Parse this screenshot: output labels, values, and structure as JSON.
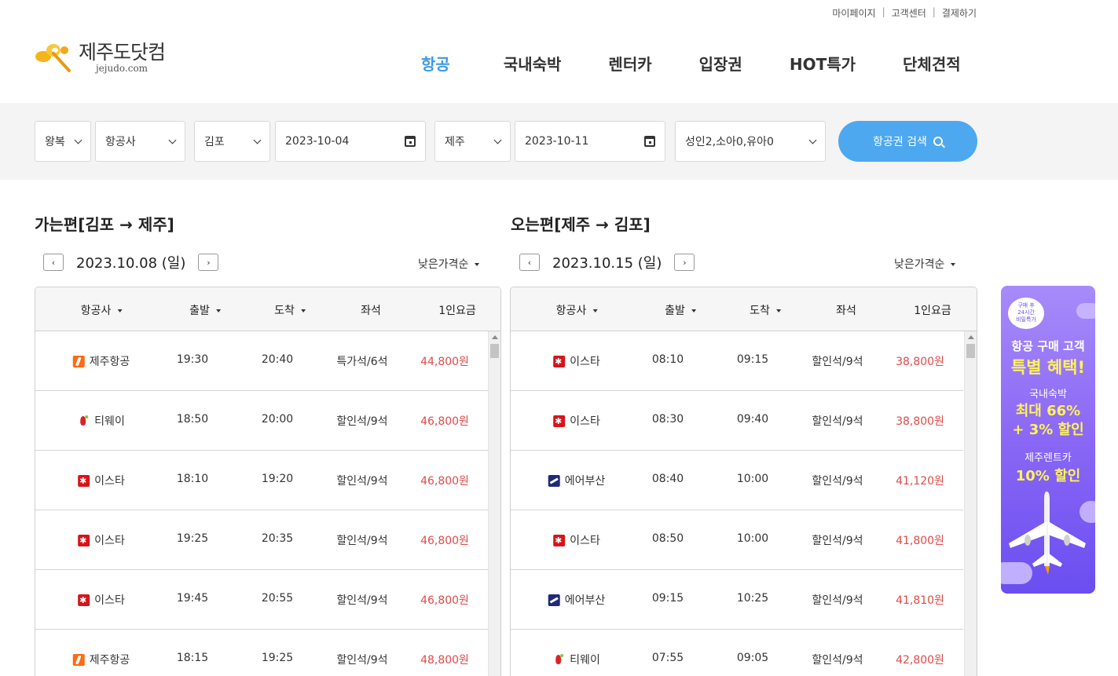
{
  "topnav": [
    "마이페이지",
    "고객센터",
    "결제하기"
  ],
  "logo": {
    "ko": "제주도닷컴",
    "en": "jejudo.com"
  },
  "mainnav": [
    {
      "label": "항공",
      "active": true
    },
    {
      "label": "국내숙박",
      "active": false
    },
    {
      "label": "렌터카",
      "active": false
    },
    {
      "label": "입장권",
      "active": false
    },
    {
      "label": "HOT특가",
      "active": false
    },
    {
      "label": "단체견적",
      "active": false
    }
  ],
  "search": {
    "trip_type": "왕복",
    "airline": "항공사",
    "origin": "김포",
    "depart_date": "2023-10-04",
    "destination": "제주",
    "return_date": "2023-10-11",
    "passengers": "성인2,소아0,유아0",
    "button": "항공권 검색"
  },
  "outbound": {
    "title": "가는편[김포 → 제주]",
    "date": "2023.10.08 (일)",
    "sort": "낮은가격순",
    "headers": [
      "항공사",
      "출발",
      "도착",
      "좌석",
      "1인요금"
    ],
    "rows": [
      {
        "airline": "제주항공",
        "logo": "jeju",
        "dep": "19:30",
        "arr": "20:40",
        "seat": "특가석/6석",
        "price": "44,800원"
      },
      {
        "airline": "티웨이",
        "logo": "tway",
        "dep": "18:50",
        "arr": "20:00",
        "seat": "할인석/9석",
        "price": "46,800원"
      },
      {
        "airline": "이스타",
        "logo": "eastar",
        "dep": "18:10",
        "arr": "19:20",
        "seat": "할인석/9석",
        "price": "46,800원"
      },
      {
        "airline": "이스타",
        "logo": "eastar",
        "dep": "19:25",
        "arr": "20:35",
        "seat": "할인석/9석",
        "price": "46,800원"
      },
      {
        "airline": "이스타",
        "logo": "eastar",
        "dep": "19:45",
        "arr": "20:55",
        "seat": "할인석/9석",
        "price": "46,800원"
      },
      {
        "airline": "제주항공",
        "logo": "jeju",
        "dep": "18:15",
        "arr": "19:25",
        "seat": "할인석/9석",
        "price": "48,800원"
      }
    ]
  },
  "inbound": {
    "title": "오는편[제주 → 김포]",
    "date": "2023.10.15 (일)",
    "sort": "낮은가격순",
    "headers": [
      "항공사",
      "출발",
      "도착",
      "좌석",
      "1인요금"
    ],
    "rows": [
      {
        "airline": "이스타",
        "logo": "eastar",
        "dep": "08:10",
        "arr": "09:15",
        "seat": "할인석/9석",
        "price": "38,800원"
      },
      {
        "airline": "이스타",
        "logo": "eastar",
        "dep": "08:30",
        "arr": "09:40",
        "seat": "할인석/9석",
        "price": "38,800원"
      },
      {
        "airline": "에어부산",
        "logo": "busan",
        "dep": "08:40",
        "arr": "10:00",
        "seat": "할인석/9석",
        "price": "41,120원"
      },
      {
        "airline": "이스타",
        "logo": "eastar",
        "dep": "08:50",
        "arr": "10:00",
        "seat": "할인석/9석",
        "price": "41,800원"
      },
      {
        "airline": "에어부산",
        "logo": "busan",
        "dep": "09:15",
        "arr": "10:25",
        "seat": "할인석/9석",
        "price": "41,810원"
      },
      {
        "airline": "티웨이",
        "logo": "tway",
        "dep": "07:55",
        "arr": "09:05",
        "seat": "할인석/9석",
        "price": "42,800원"
      }
    ]
  },
  "banner": {
    "badge": [
      "구매 후",
      "24시간",
      "비밀특가"
    ],
    "line1": "항공 구매 고객",
    "line2": "특별 혜택!",
    "line3": "국내숙박",
    "line4a": "최대 66%",
    "line4b": "+ 3% 할인",
    "line5": "제주렌트카",
    "line6": "10% 할인"
  },
  "colors": {
    "accent": "#3b9ae6",
    "button": "#4da8f0",
    "price": "#e04a4a",
    "banner": "#8a67f5"
  }
}
